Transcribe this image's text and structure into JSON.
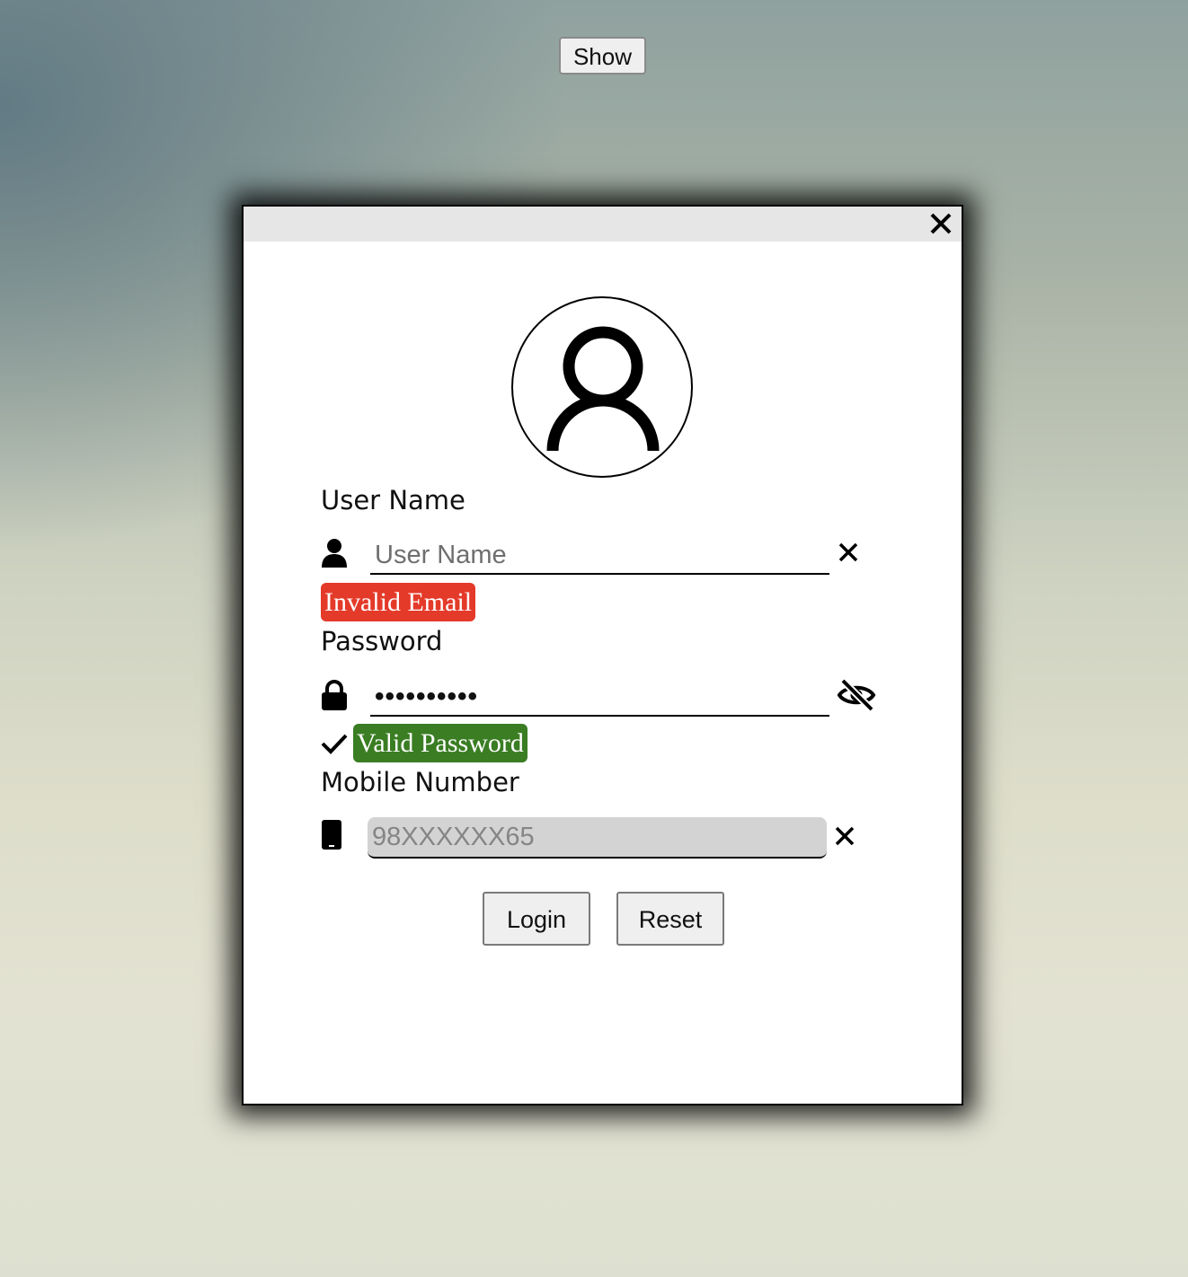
{
  "show_button": {
    "label": "Show"
  },
  "modal": {
    "close_icon": "close-icon",
    "avatar_icon": "user-circle-icon"
  },
  "username": {
    "label": "User Name",
    "placeholder": "User Name",
    "value": "",
    "icon": "user-icon",
    "clear_icon": "clear-icon",
    "validation": {
      "text": "Invalid Email",
      "status": "error",
      "color": "#e43a2a"
    }
  },
  "password": {
    "label": "Password",
    "value": "••••••••••",
    "icon": "lock-icon",
    "toggle_icon": "eye-slash-icon",
    "validation": {
      "text": "Valid Password",
      "status": "success",
      "color": "#3a7d23",
      "check_icon": "check-icon"
    }
  },
  "mobile": {
    "label": "Mobile Number",
    "placeholder": "98XXXXXX65",
    "value": "",
    "icon": "mobile-phone-icon",
    "clear_icon": "clear-icon"
  },
  "actions": {
    "login_label": "Login",
    "reset_label": "Reset"
  }
}
